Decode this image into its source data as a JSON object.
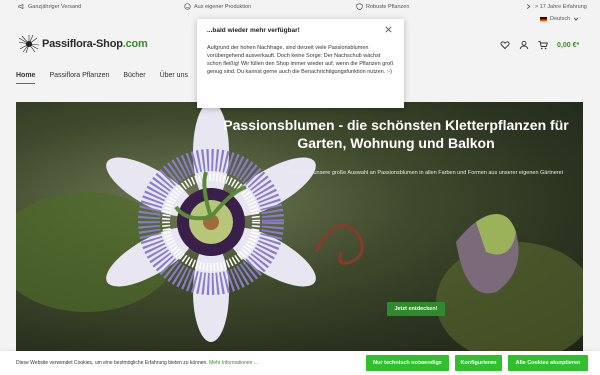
{
  "topbar": {
    "usps": [
      {
        "icon": "megaphone-icon",
        "text": "Ganzjähriger Versand"
      },
      {
        "icon": "smile-icon",
        "text": "Aus eigener Produktion"
      },
      {
        "icon": "shield-icon",
        "text": "Robuste Pflanzen"
      },
      {
        "icon": "chevron-right-icon",
        "text": "> 17 Jahre Erfahrung"
      }
    ],
    "language": "Deutsch"
  },
  "header": {
    "logo_main": "Passiflora-Shop",
    "logo_tld": ".com",
    "cart_total": "0,00 €*"
  },
  "nav": {
    "items": [
      "Home",
      "Passiflora Pflanzen",
      "Bücher",
      "Über uns"
    ]
  },
  "hero": {
    "title": "Passionsblumen - die schönsten Kletterpflanzen für Garten, Wohnung und Balkon",
    "subtitle": "Entdecke unsere große Auswahl an Passionsblumen in allen Farben und Formen aus unserer eigenen Gärtnerei",
    "button": "Jetzt entdecken!"
  },
  "modal": {
    "title": "...bald wieder mehr verfügbar!",
    "body": "Aufgrund der hohen Nachfrage, sind derzeit viele Passionsblumen vorübergehend ausverkauft. Doch keine Sorge: Der Nachschub wächst schon fleißig! Wir füllen den Shop immer wieder auf, wenn die Pflanzen groß genug sind. Du kannst gerne auch die Benachrichtigungsfunktion nutzen. :-)"
  },
  "cookie": {
    "text": "Diese Website verwendet Cookies, um eine bestmögliche Erfahrung bieten zu können.",
    "link": "Mehr Informationen ...",
    "btn_necessary": "Nur technisch notwendige",
    "btn_configure": "Konfigurieren",
    "btn_accept": "Alle Cookies akzeptieren"
  },
  "colors": {
    "accent": "#3a8a2c",
    "cookie_button": "#2fbf2f"
  }
}
